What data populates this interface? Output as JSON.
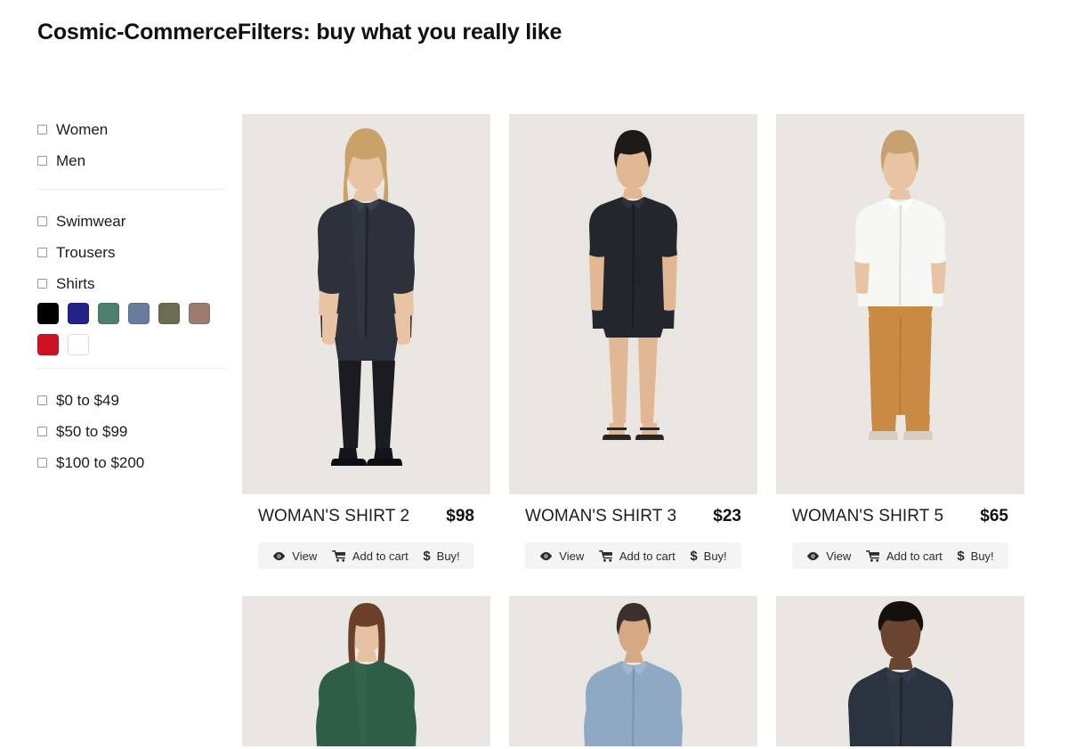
{
  "header": {
    "title": "Cosmic-CommerceFilters: buy what you really like"
  },
  "sidebar": {
    "gender_filters": [
      {
        "label": "Women",
        "checked": false
      },
      {
        "label": "Men",
        "checked": false
      }
    ],
    "category_filters": [
      {
        "label": "Swimwear",
        "checked": false
      },
      {
        "label": "Trousers",
        "checked": false
      },
      {
        "label": "Shirts",
        "checked": false
      }
    ],
    "color_swatches": [
      {
        "name": "black",
        "hex": "#000000"
      },
      {
        "name": "navy",
        "hex": "#232287"
      },
      {
        "name": "teal",
        "hex": "#4c7f70"
      },
      {
        "name": "slate",
        "hex": "#687c9e"
      },
      {
        "name": "olive",
        "hex": "#6d6b50"
      },
      {
        "name": "taupe",
        "hex": "#9a7d70"
      },
      {
        "name": "red",
        "hex": "#cf1124"
      },
      {
        "name": "white",
        "hex": "#ffffff"
      }
    ],
    "price_filters": [
      {
        "label": "$0 to $49",
        "checked": false
      },
      {
        "label": "$50 to $99",
        "checked": false
      },
      {
        "label": "$100 to $200",
        "checked": false
      }
    ]
  },
  "actions": {
    "view_label": "View",
    "cart_label": "Add to cart",
    "buy_label": "Buy!"
  },
  "products": [
    {
      "name": "WOMAN'S SHIRT 2",
      "price": "$98",
      "garment_color": "#2c313c",
      "hair": "#c9a26a",
      "skin": "#e8c4a4",
      "style": "dress-tights"
    },
    {
      "name": "WOMAN'S SHIRT 3",
      "price": "$23",
      "garment_color": "#23262c",
      "hair": "#1d1a18",
      "skin": "#e2b793",
      "style": "dress-short"
    },
    {
      "name": "WOMAN'S SHIRT 5",
      "price": "$65",
      "garment_color": "#f7f7f5",
      "hair": "#c8a171",
      "skin": "#e8c4a4",
      "style": "shirt-trousers",
      "trousers_color": "#c98a43"
    },
    {
      "name": "",
      "price": "",
      "garment_color": "#2e5e46",
      "hair": "#6b3f2a",
      "skin": "#e5c0a2",
      "style": "bust"
    },
    {
      "name": "",
      "price": "",
      "garment_color": "#8fa9c4",
      "hair": "#3a2f2a",
      "skin": "#d6a883",
      "style": "bust"
    },
    {
      "name": "",
      "price": "",
      "garment_color": "#2b3340",
      "hair": "#14100e",
      "skin": "#6b4430",
      "style": "bust"
    }
  ]
}
